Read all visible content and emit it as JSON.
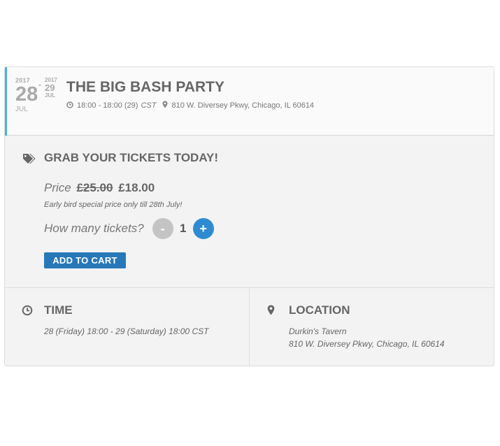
{
  "colors": {
    "accent": "#4bb3d8",
    "button_blue": "#2778b8",
    "plus_blue": "#2e8bd0",
    "minus_gray": "#c4c4c4"
  },
  "event": {
    "start_year": "2017",
    "start_day": "28",
    "start_month": "JUL",
    "separator": "-",
    "end_year": "2017",
    "end_day": "29",
    "end_month": "JUL",
    "title": "THE BIG BASH PARTY",
    "time_range": "18:00 - 18:00 (29)",
    "timezone": "CST",
    "address": "810 W. Diversey Pkwy, Chicago, IL 60614",
    "clock_icon": "clock-icon",
    "pin_icon": "map-pin-icon"
  },
  "tickets": {
    "heading": "GRAB YOUR TICKETS TODAY!",
    "heading_icon": "tags-icon",
    "price_label": "Price",
    "price_old": "£25.00",
    "price_new": "£18.00",
    "note": "Early bird special price only till 28th July!",
    "qty_label": "How many tickets?",
    "minus_label": "-",
    "qty_value": "1",
    "plus_label": "+",
    "add_label": "ADD TO CART"
  },
  "time": {
    "heading": "TIME",
    "text": "28 (Friday) 18:00 - 29 (Saturday) 18:00 CST"
  },
  "location": {
    "heading": "LOCATION",
    "venue": "Durkin's Tavern",
    "address": "810 W. Diversey Pkwy, Chicago, IL 60614"
  }
}
